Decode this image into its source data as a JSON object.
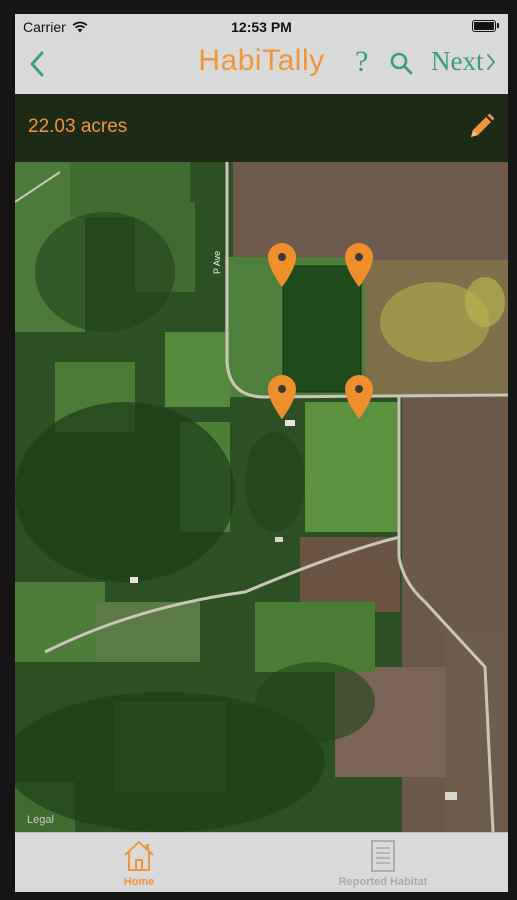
{
  "status": {
    "carrier": "Carrier",
    "time": "12:53 PM"
  },
  "nav": {
    "title": "HabiTally",
    "help": "?",
    "next": "Next",
    "back_icon": "chevron-left-icon",
    "search_icon": "search-icon"
  },
  "area": {
    "acres": "22.03 acres",
    "edit_icon": "pencil-icon"
  },
  "map": {
    "legal": "Legal",
    "road_label": "P Ave",
    "pin_count": 4
  },
  "tabs": [
    {
      "label": "Home",
      "icon": "home-icon",
      "active": true
    },
    {
      "label": "Reported Habitat",
      "icon": "document-icon",
      "active": false
    }
  ],
  "colors": {
    "accent": "#f0953a",
    "nav_green": "#3e9e76",
    "header_bg": "#1d2a15"
  }
}
